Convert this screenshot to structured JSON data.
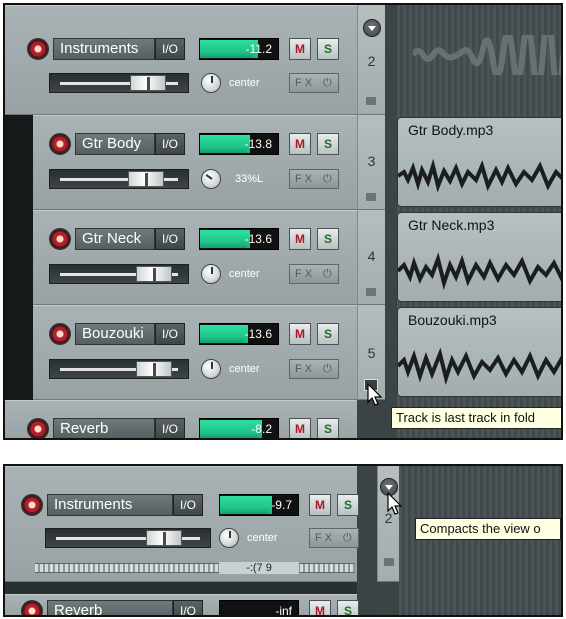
{
  "top_panel": {
    "tracks": [
      {
        "name": "Instruments",
        "io": "I/O",
        "vu": "-11.2",
        "mute": "M",
        "solo": "S",
        "pan": "center",
        "fx": "F X",
        "power": "⏻",
        "number": "2"
      },
      {
        "name": "Gtr Body",
        "io": "I/O",
        "vu": "-13.8",
        "mute": "M",
        "solo": "S",
        "pan": "33%L",
        "fx": "F X",
        "power": "⏻",
        "number": "3"
      },
      {
        "name": "Gtr Neck",
        "io": "I/O",
        "vu": "-13.6",
        "mute": "M",
        "solo": "S",
        "pan": "center",
        "fx": "F X",
        "power": "⏻",
        "number": "4"
      },
      {
        "name": "Bouzouki",
        "io": "I/O",
        "vu": "-13.6",
        "mute": "M",
        "solo": "S",
        "pan": "center",
        "fx": "F X",
        "power": "⏻",
        "number": "5"
      },
      {
        "name": "Reverb",
        "io": "I/O",
        "vu": "-8.2",
        "mute": "M",
        "solo": "S"
      }
    ],
    "items": [
      {
        "label": "Gtr Body.mp3"
      },
      {
        "label": "Gtr Neck.mp3"
      },
      {
        "label": "Bouzouki.mp3"
      }
    ],
    "tooltip": "Track is last track in fold"
  },
  "bottom_panel": {
    "tracks": [
      {
        "name": "Instruments",
        "io": "I/O",
        "vu": "-9.7",
        "mute": "M",
        "solo": "S",
        "pan": "center",
        "fx": "F X",
        "power": "⏻",
        "number": "2",
        "collapsed_label": "-:(7 9"
      },
      {
        "name": "Reverb",
        "io": "I/O",
        "vu": "-inf",
        "mute": "M",
        "solo": "S"
      }
    ],
    "tooltip": "Compacts the view o"
  },
  "colors": {
    "background": "#3b4346",
    "track_panel": "#a9b3b5",
    "meter": "#2fe0a0",
    "mute": "#b01520",
    "solo": "#246a2a",
    "tooltip": "#ffffe1"
  },
  "icons": {
    "record_arm": "record-arm-icon",
    "folder": "folder-icon",
    "collapse": "folder-collapse-icon",
    "cursor": "mouse-pointer-icon"
  }
}
